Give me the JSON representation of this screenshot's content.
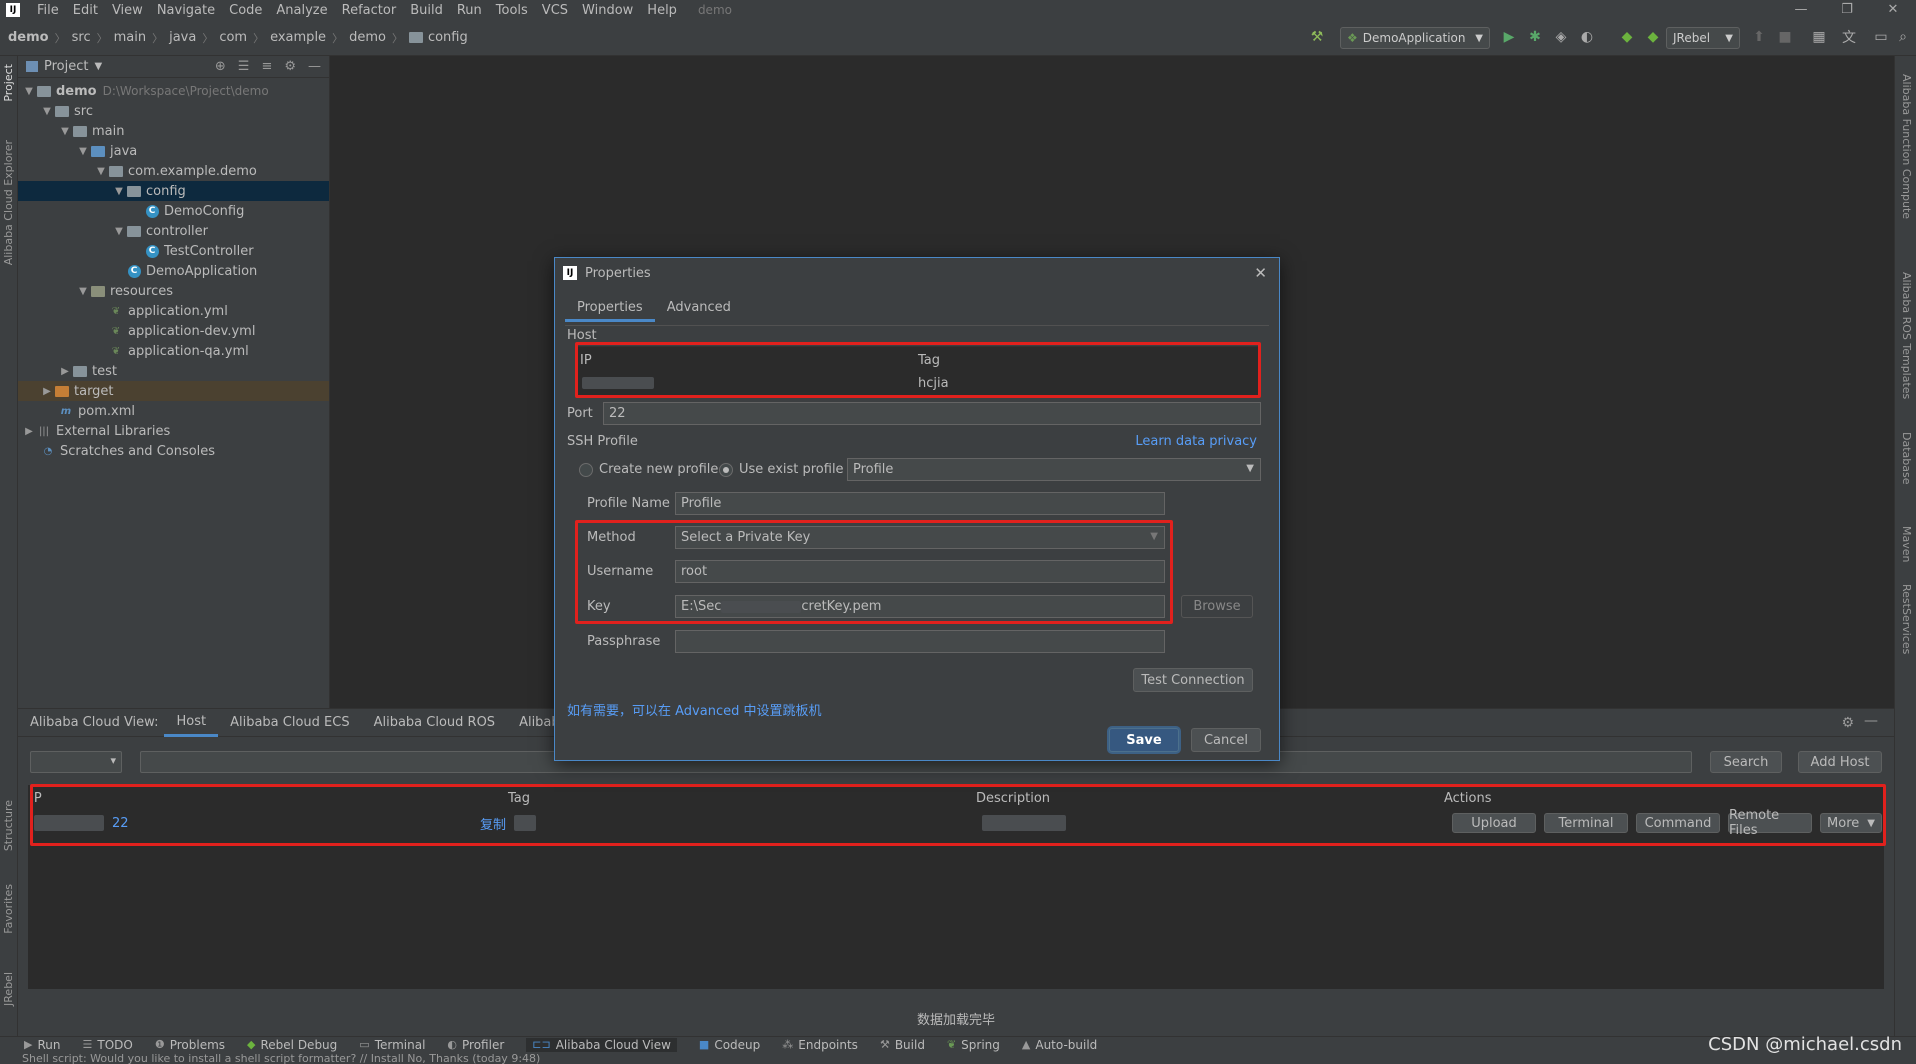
{
  "menubar": {
    "items": [
      "File",
      "Edit",
      "View",
      "Navigate",
      "Code",
      "Analyze",
      "Refactor",
      "Build",
      "Run",
      "Tools",
      "VCS",
      "Window",
      "Help"
    ],
    "project_name": "demo"
  },
  "breadcrumb": [
    "demo",
    "src",
    "main",
    "java",
    "com",
    "example",
    "demo",
    "config"
  ],
  "toolbar": {
    "run_config": "DemoApplication",
    "jrebel": "JRebel"
  },
  "left_strip": [
    "Project",
    "Alibaba Cloud Explorer",
    "Structure",
    "Favorites",
    "JRebel"
  ],
  "right_strip": [
    "Alibaba Function Compute",
    "Alibaba ROS Templates",
    "Database",
    "Maven",
    "RestServices"
  ],
  "project_panel": {
    "title": "Project",
    "tree": [
      {
        "label": "demo",
        "path": "D:\\Workspace\\Project\\demo"
      },
      {
        "label": "src"
      },
      {
        "label": "main"
      },
      {
        "label": "java"
      },
      {
        "label": "com.example.demo"
      },
      {
        "label": "config"
      },
      {
        "label": "DemoConfig"
      },
      {
        "label": "controller"
      },
      {
        "label": "TestController"
      },
      {
        "label": "DemoApplication"
      },
      {
        "label": "resources"
      },
      {
        "label": "application.yml"
      },
      {
        "label": "application-dev.yml"
      },
      {
        "label": "application-qa.yml"
      },
      {
        "label": "test"
      },
      {
        "label": "target"
      },
      {
        "label": "pom.xml"
      },
      {
        "label": "External Libraries"
      },
      {
        "label": "Scratches and Consoles"
      }
    ]
  },
  "bottom_panel": {
    "title": "Alibaba Cloud View:",
    "tabs": [
      "Host",
      "Alibaba Cloud ECS",
      "Alibaba Cloud ROS",
      "Alibaba Mini"
    ],
    "search_label": "Search",
    "add_host_label": "Add Host",
    "columns": [
      "IP",
      "Tag",
      "Description",
      "Actions"
    ],
    "row": {
      "port": "22",
      "copy_label": "复制",
      "actions": [
        "Upload",
        "Terminal",
        "Command",
        "Remote Files",
        "More"
      ]
    },
    "status_message": "数据加载完毕"
  },
  "dialog": {
    "title": "Properties",
    "tabs": [
      "Properties",
      "Advanced"
    ],
    "host_label": "Host",
    "host_table": {
      "ip_header": "IP",
      "tag_header": "Tag",
      "tag_value": "hcjia"
    },
    "port_label": "Port",
    "port_value": "22",
    "ssh_profile_label": "SSH Profile",
    "learn_link": "Learn data privacy",
    "radio_create": "Create new profile",
    "radio_use": "Use exist profile",
    "profile_select": "Profile",
    "profile_name_label": "Profile Name",
    "profile_name_value": "Profile",
    "method_label": "Method",
    "method_value": "Select a Private Key",
    "username_label": "Username",
    "username_value": "root",
    "key_label": "Key",
    "key_value_prefix": "E:\\Sec",
    "key_value_suffix": "cretKey.pem",
    "browse_label": "Browse",
    "passphrase_label": "Passphrase",
    "test_connection_label": "Test Connection",
    "hint": "如有需要，可以在 Advanced 中设置跳板机",
    "save_label": "Save",
    "cancel_label": "Cancel"
  },
  "tool_windows": [
    "Run",
    "TODO",
    "Problems",
    "Rebel Debug",
    "Terminal",
    "Profiler",
    "Alibaba Cloud View",
    "Codeup",
    "Endpoints",
    "Build",
    "Spring",
    "Auto-build"
  ],
  "statusbar_text": "Shell script: Would you like to install a shell script formatter? // Install   No, Thanks (today 9:48)",
  "watermark": "CSDN @michael.csdn",
  "colors": {
    "highlight_box": "#e1211d",
    "accent": "#4a88c7",
    "link": "#589df6"
  }
}
